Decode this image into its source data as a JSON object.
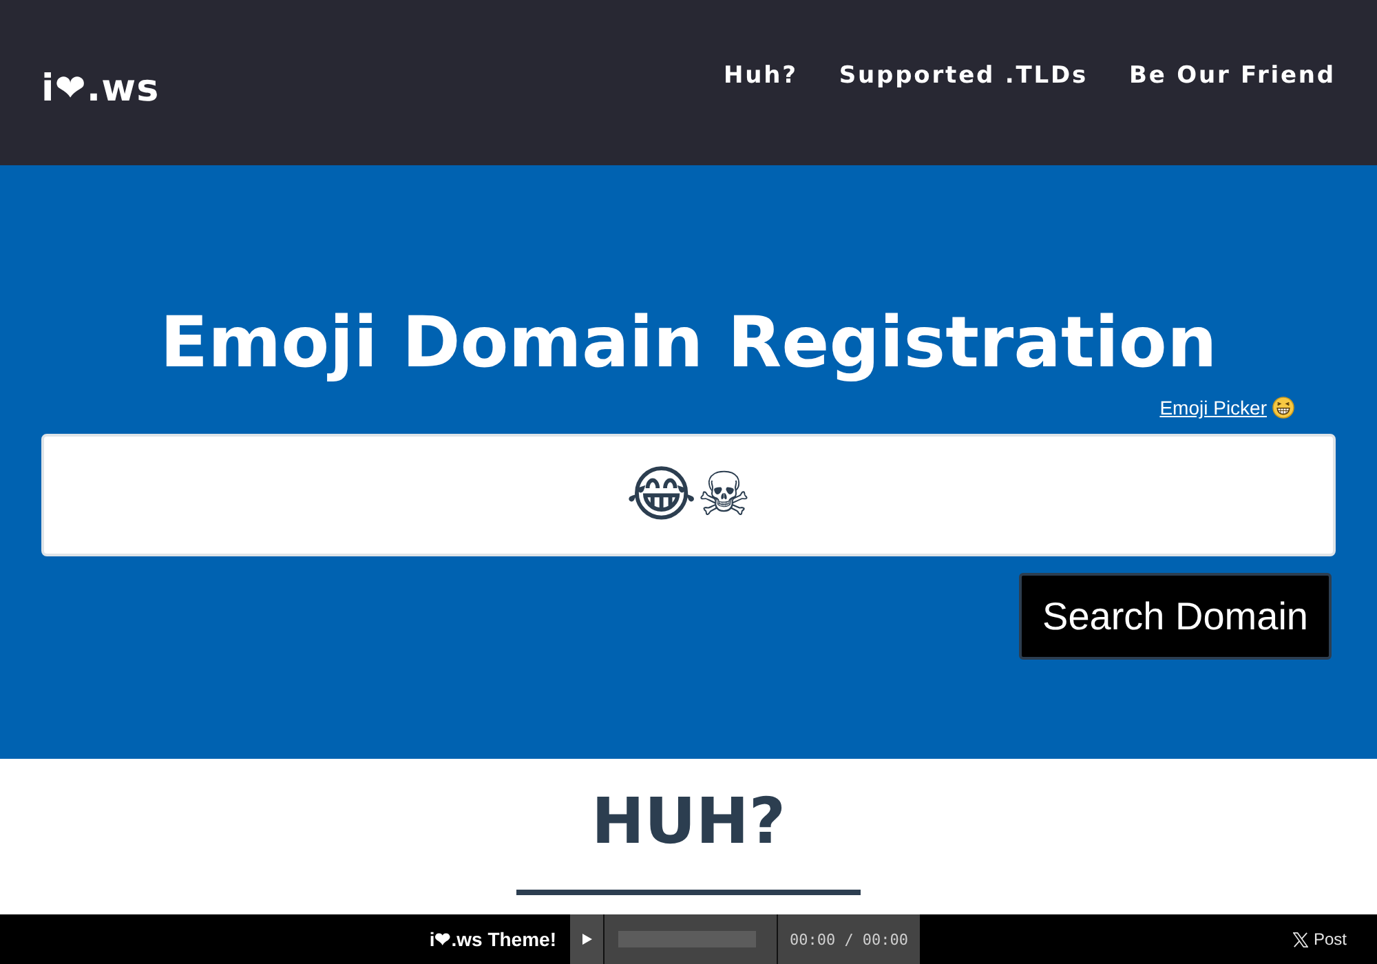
{
  "header": {
    "logo": "i❤.ws",
    "nav": [
      "Huh?",
      "Supported .TLDs",
      "Be Our Friend"
    ]
  },
  "hero": {
    "title": "Emoji Domain Registration",
    "emoji_picker_link": "Emoji Picker",
    "search": {
      "value": "😂☠"
    },
    "search_button": "Search Domain"
  },
  "section": {
    "heading": "HUH?"
  },
  "footer_bar": {
    "theme_label": "i❤.ws Theme!",
    "player": {
      "time": "00:00 / 00:00"
    },
    "post_button": "Post"
  }
}
